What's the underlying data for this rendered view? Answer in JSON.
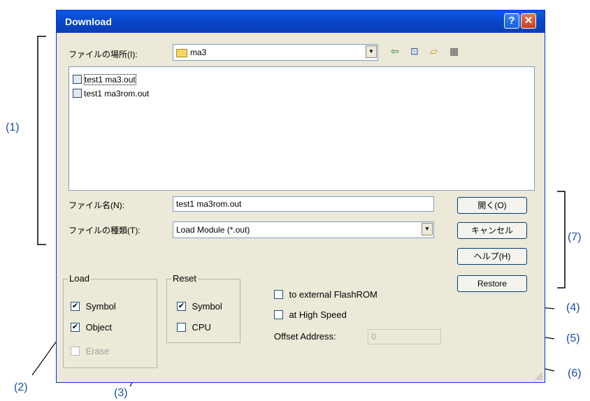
{
  "window": {
    "title": "Download"
  },
  "location": {
    "label": "ファイルの場所(I):",
    "value": "ma3"
  },
  "files": [
    "test1 ma3.out",
    "test1 ma3rom.out"
  ],
  "filename": {
    "label": "ファイル名(N):",
    "value": "test1 ma3rom.out"
  },
  "filetype": {
    "label": "ファイルの種類(T):",
    "value": "Load Module (*.out)"
  },
  "buttons": {
    "open": "開く(O)",
    "cancel": "キャンセル",
    "help": "ヘルプ(H)",
    "restore": "Restore"
  },
  "load_group": {
    "title": "Load",
    "symbol": "Symbol",
    "object": "Object",
    "erase": "Erase",
    "symbol_checked": true,
    "object_checked": true,
    "erase_checked": false
  },
  "reset_group": {
    "title": "Reset",
    "symbol": "Symbol",
    "cpu": "CPU",
    "symbol_checked": true,
    "cpu_checked": false
  },
  "options": {
    "flashrom": "to external FlashROM",
    "highspeed": "at High Speed",
    "offset_label": "Offset Address:",
    "offset_value": "0"
  },
  "annotations": {
    "a1": "(1)",
    "a2": "(2)",
    "a3": "(3)",
    "a4": "(4)",
    "a5": "(5)",
    "a6": "(6)",
    "a7": "(7)"
  }
}
